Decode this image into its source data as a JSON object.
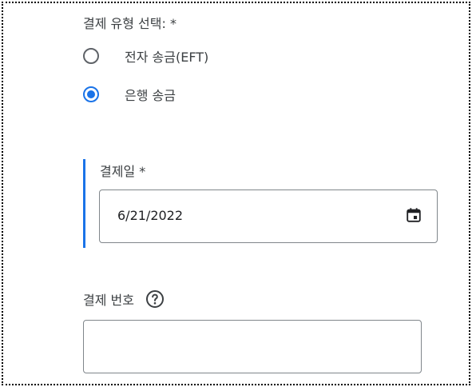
{
  "payment_type": {
    "label": "결제 유형 선택: *",
    "options": [
      {
        "label": "전자 송금(EFT)",
        "selected": false
      },
      {
        "label": "은행 송금",
        "selected": true
      }
    ]
  },
  "payment_date": {
    "label": "결제일 *",
    "value": "6/21/2022",
    "icon": "calendar-icon"
  },
  "payment_number": {
    "label": "결제 번호",
    "value": "",
    "placeholder": "",
    "icon": "help-icon"
  },
  "colors": {
    "accent": "#1a73e8",
    "text": "#3c4043",
    "border": "#80868b"
  }
}
